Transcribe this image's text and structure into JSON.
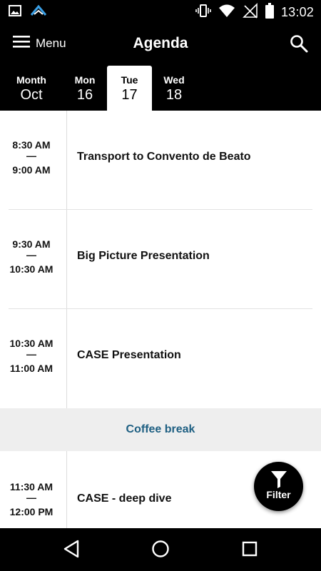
{
  "status_bar": {
    "time": "13:02",
    "icons": [
      "image-icon",
      "app-notification-icon",
      "vibrate-icon",
      "wifi-icon",
      "no-signal-icon",
      "battery-icon"
    ]
  },
  "app_bar": {
    "menu_label": "Menu",
    "title": "Agenda"
  },
  "day_tabs": [
    {
      "top": "Month",
      "bottom": "Oct"
    },
    {
      "top": "Mon",
      "bottom": "16"
    },
    {
      "top": "Tue",
      "bottom": "17"
    },
    {
      "top": "Wed",
      "bottom": "18"
    }
  ],
  "selected_tab": "Tue 17",
  "sessions": [
    {
      "start": "8:30 AM",
      "end": "9:00 AM",
      "title": "Transport to Convento de Beato"
    },
    {
      "start": "9:30 AM",
      "end": "10:30 AM",
      "title": "Big Picture Presentation"
    },
    {
      "start": "10:30 AM",
      "end": "11:00 AM",
      "title": "CASE Presentation"
    },
    {
      "start": "11:30 AM",
      "end": "12:00 PM",
      "title": "CASE - deep dive"
    }
  ],
  "break": {
    "label": "Coffee break"
  },
  "dash": "—",
  "fab": {
    "label": "Filter"
  },
  "colors": {
    "bar_background": "#000000",
    "break_background": "#eeeeee",
    "break_text": "#1e5f82",
    "text": "#111111"
  }
}
